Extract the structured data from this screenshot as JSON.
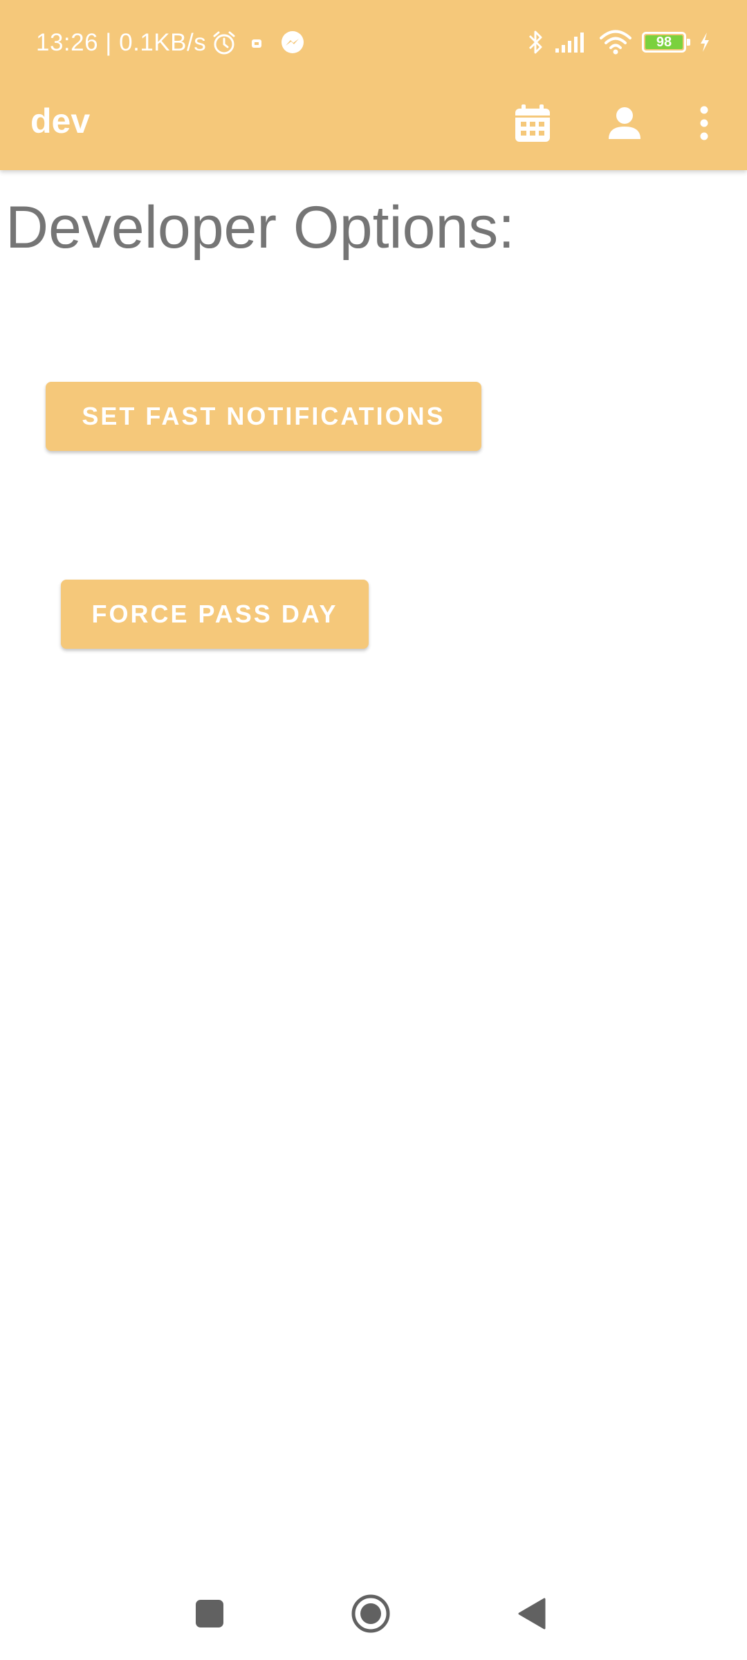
{
  "status_bar": {
    "time": "13:26 | 0.1KB/s",
    "battery_level": "98",
    "icons": [
      "alarm-clock-icon",
      "notification-icon",
      "messenger-icon",
      "bluetooth-icon",
      "cellular-signal-icon",
      "wifi-icon",
      "battery-icon",
      "charging-icon"
    ]
  },
  "app_bar": {
    "title": "dev",
    "actions": [
      "calendar-icon",
      "account-icon",
      "more-options-icon"
    ]
  },
  "main": {
    "heading": "Developer Options:",
    "buttons": {
      "fast_notifications": "SET FAST NOTIFICATIONS",
      "force_pass_day": "FORCE PASS DAY"
    }
  },
  "nav_bar": {
    "buttons": [
      "recent-apps-icon",
      "home-icon",
      "back-icon"
    ]
  },
  "colors": {
    "primary": "#f5c87a",
    "heading_text": "#757575",
    "on_primary": "#ffffff",
    "nav_icons": "#616161",
    "battery_fill": "#7bd13d"
  }
}
